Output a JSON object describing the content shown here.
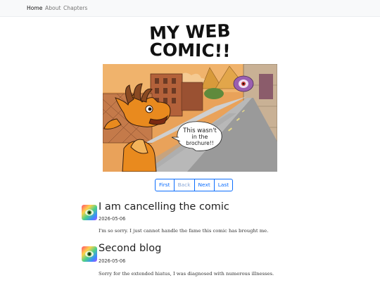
{
  "nav": {
    "items": [
      {
        "label": "Home",
        "active": true
      },
      {
        "label": "About",
        "active": false
      },
      {
        "label": "Chapters",
        "active": false
      }
    ]
  },
  "site": {
    "title_line1": "MY WEB",
    "title_line2": "COMIC!!"
  },
  "comic": {
    "speech_line1": "This wasn't",
    "speech_line2": "in the",
    "speech_line3": "brochure!!"
  },
  "pager": {
    "first": "First",
    "back": "Back",
    "next": "Next",
    "last": "Last"
  },
  "posts": [
    {
      "title": "I am cancelling the comic",
      "date": "2026-05-06",
      "body": "I'm so sorry. I just cannot handle the fame this comic has brought me."
    },
    {
      "title": "Second blog",
      "date": "2026-05-06",
      "body": "Sorry for the extended hiatus, I was diagnosed with numerous illnesses."
    }
  ]
}
